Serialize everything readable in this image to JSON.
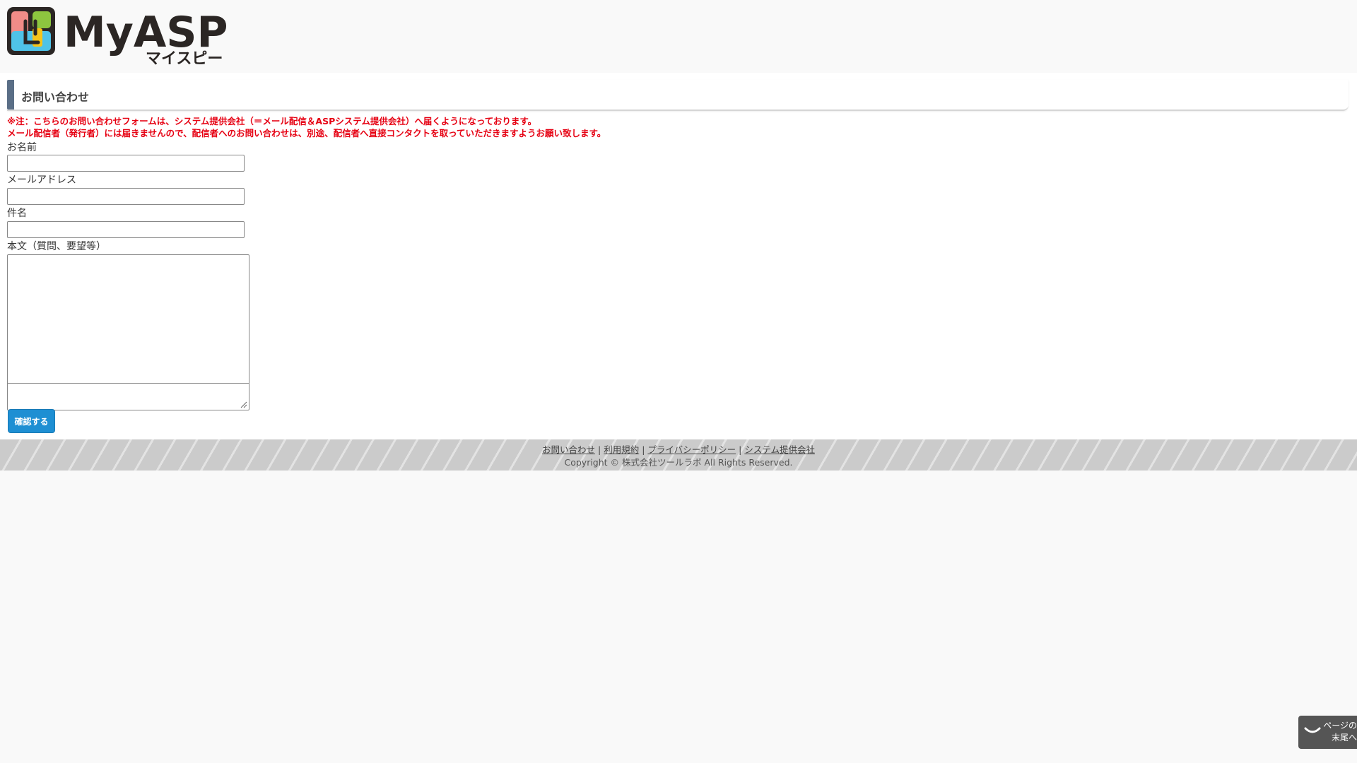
{
  "header": {
    "logo_text": "MyASP",
    "logo_subtext": "マイスピー"
  },
  "page": {
    "title": "お問い合わせ"
  },
  "notice": {
    "line1": "※注：こちらのお問い合わせフォームは、システム提供会社（＝メール配信＆ASPシステム提供会社）へ届くようになっております。",
    "line2": "メール配信者（発行者）には届きませんので、配信者へのお問い合わせは、別途、配信者へ直接コンタクトを取っていただきますようお願い致します。"
  },
  "form": {
    "name_label": "お名前",
    "name_value": "",
    "email_label": "メールアドレス",
    "email_value": "",
    "subject_label": "件名",
    "subject_value": "",
    "body_label": "本文（質問、要望等）",
    "body_value": "",
    "confirm_label": "確認する"
  },
  "footer": {
    "links": [
      "お問い合わせ",
      "利用規約",
      "プライバシーポリシー",
      "システム提供会社"
    ],
    "separator": " | ",
    "copyright": "Copyright © 株式会社ツールラボ All Rights Reserved."
  },
  "scroll_button": {
    "line1": "ページの",
    "line2": "末尾へ"
  },
  "colors": {
    "notice": "#e60012",
    "button": "#1e8fd3",
    "heading_bar": "#5a6e86",
    "logo_dark": "#2b2624"
  },
  "icons": {
    "logo": "myasp-logo-icon",
    "scroll": "chevron-down-icon"
  }
}
